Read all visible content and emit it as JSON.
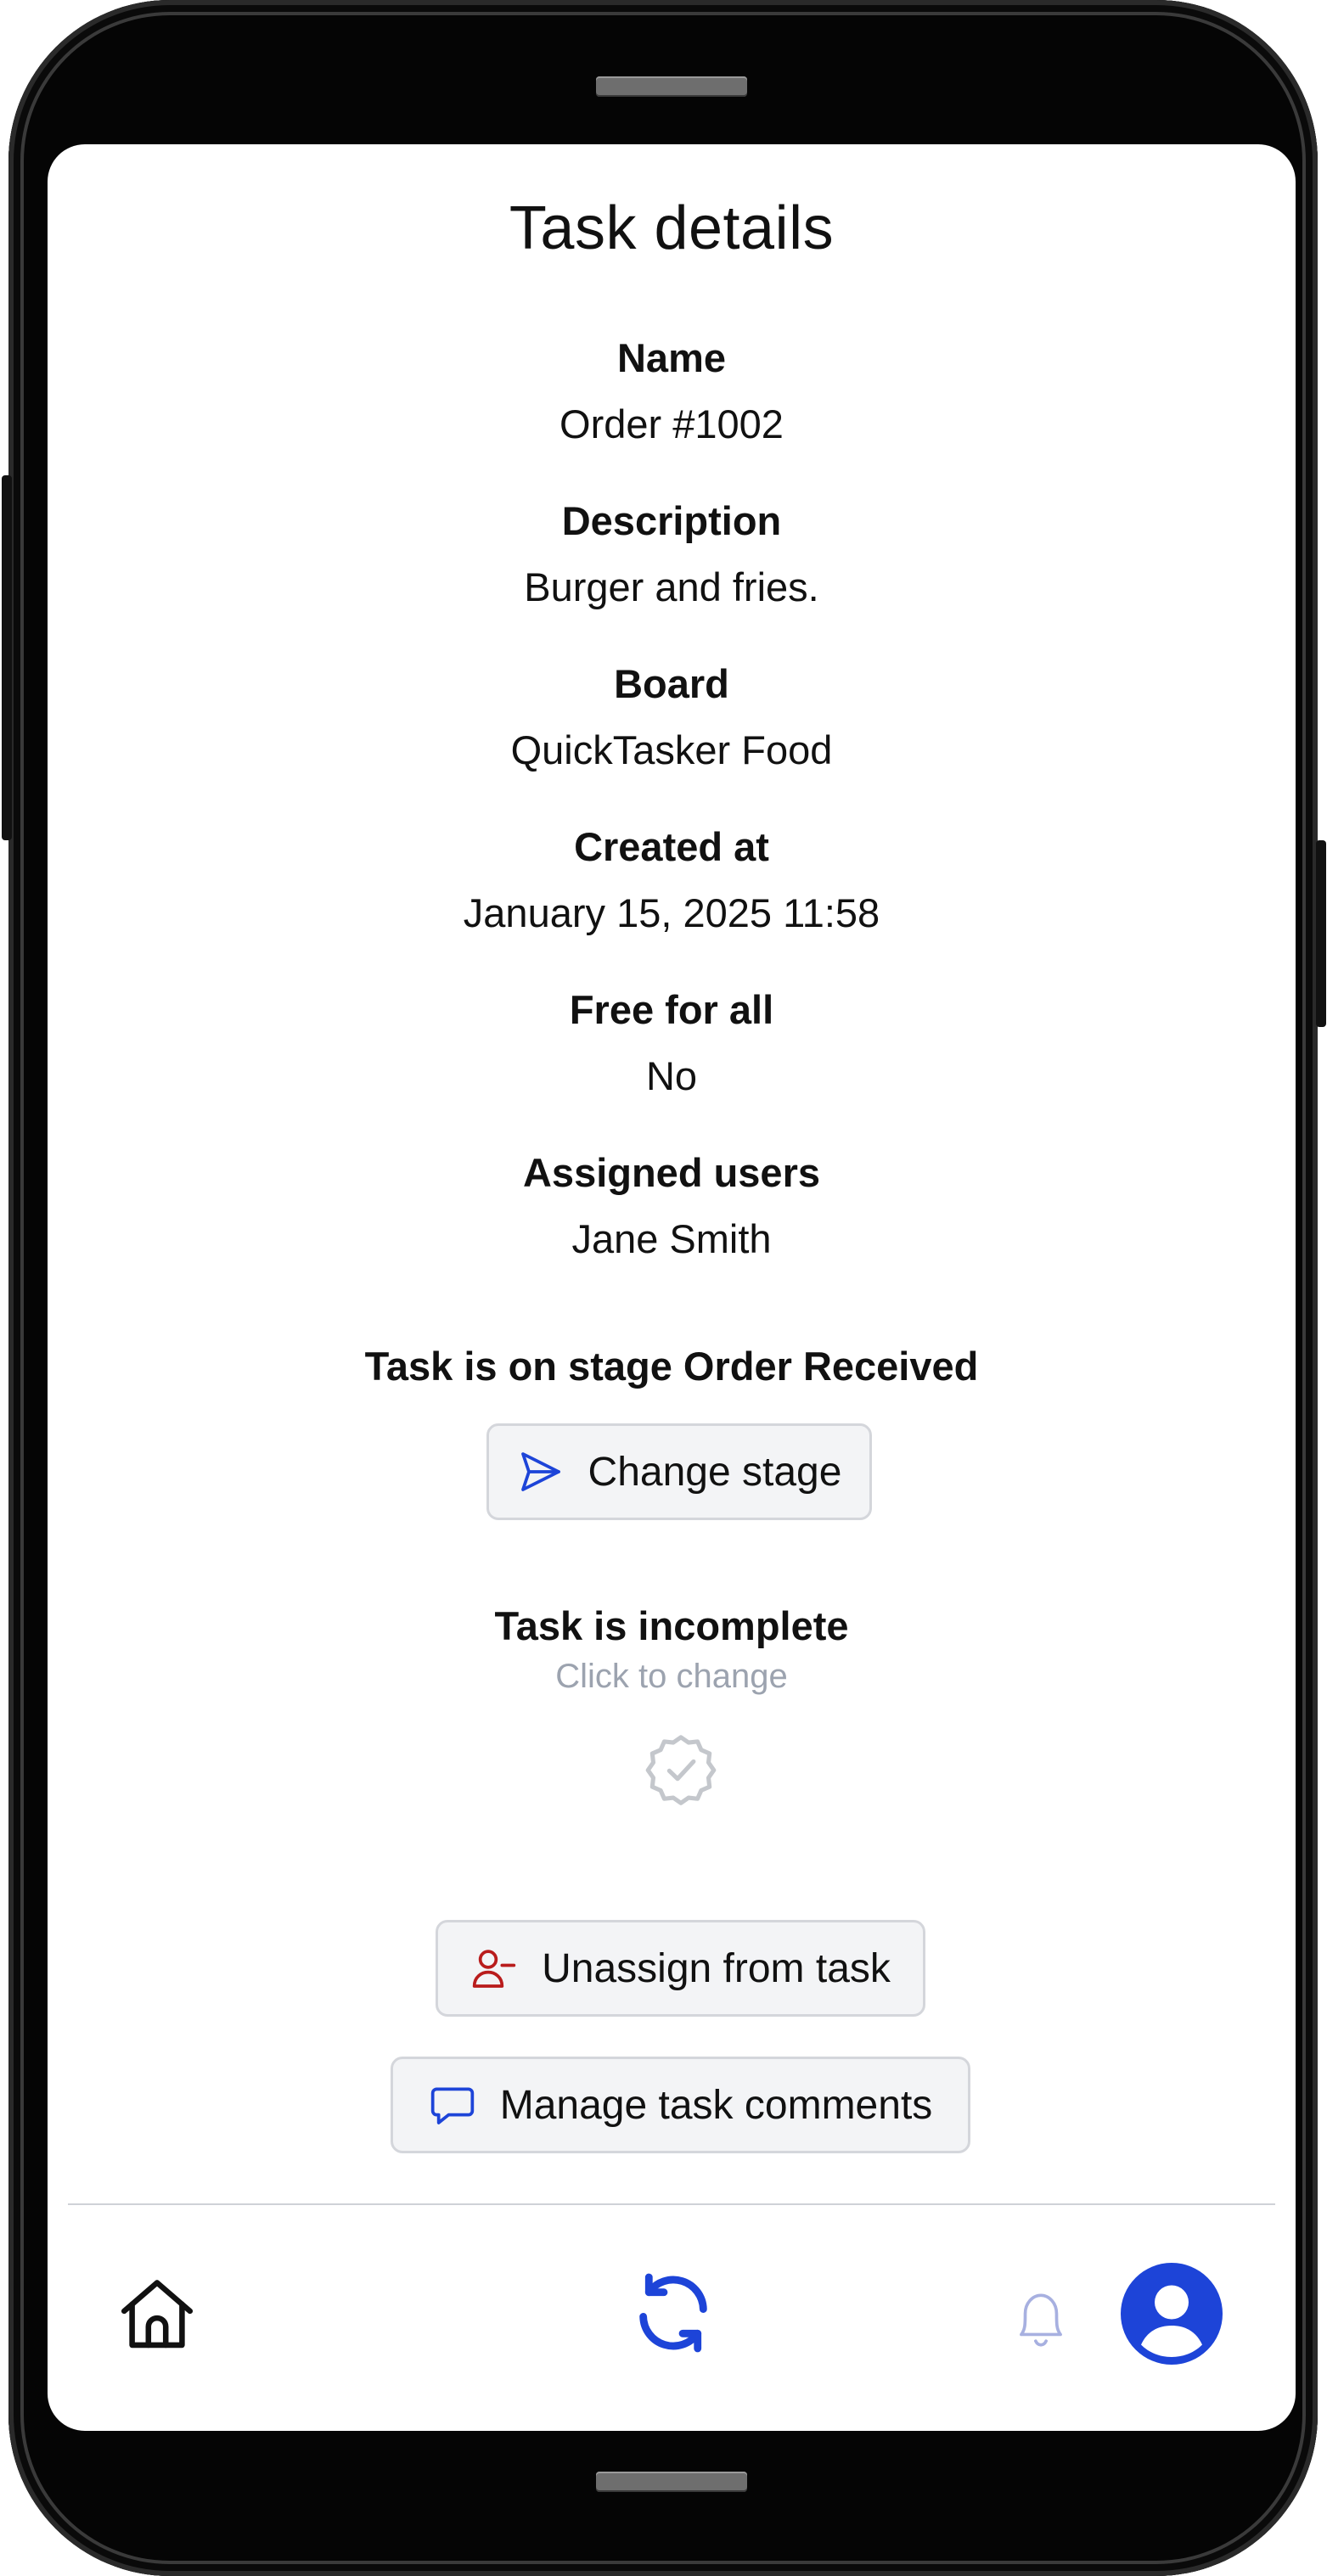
{
  "page": {
    "title": "Task details"
  },
  "fields": [
    {
      "label": "Name",
      "value": "Order #1002"
    },
    {
      "label": "Description",
      "value": "Burger and fries."
    },
    {
      "label": "Board",
      "value": "QuickTasker Food"
    },
    {
      "label": "Created at",
      "value": "January 15, 2025 11:58"
    },
    {
      "label": "Free for all",
      "value": "No"
    },
    {
      "label": "Assigned users",
      "value": "Jane Smith"
    }
  ],
  "stage": {
    "text": "Task is on stage Order Received",
    "button_label": "Change stage",
    "button_icon": "send-icon"
  },
  "completion": {
    "status_text": "Task is incomplete",
    "hint": "Click to change",
    "icon": "check-badge-icon"
  },
  "actions": {
    "unassign_label": "Unassign from task",
    "unassign_icon": "user-minus-icon",
    "comments_label": "Manage task comments",
    "comments_icon": "chat-bubble-icon"
  },
  "nav": {
    "items": [
      "home-icon",
      "refresh-icon",
      "bell-icon",
      "user-avatar-icon"
    ]
  },
  "colors": {
    "accent": "#1d44d8",
    "danger": "#b91c1c",
    "muted": "#9ca3af",
    "button_bg": "#f3f4f6",
    "button_border": "#d4d6db"
  }
}
